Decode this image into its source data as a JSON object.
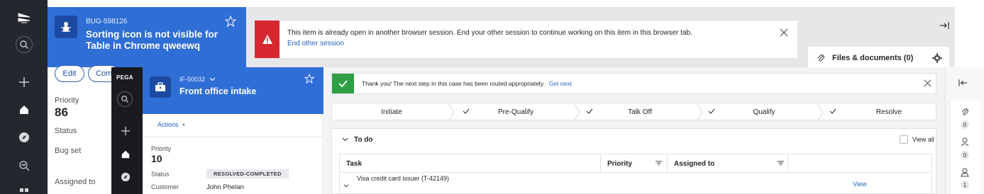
{
  "back_window": {
    "case_id": "BUG-598126",
    "case_title": "Sorting icon is not visible for Table in Chrome qweewq",
    "alert": {
      "message": "This item is already open in another browser session. End your other session to continue working on this item in this browser tab.",
      "link": "End other session"
    },
    "actions": {
      "edit": "Edit",
      "comment": "Com"
    },
    "fields": {
      "priority_label": "Priority",
      "priority_value": "86",
      "status_label": "Status",
      "bug_set_label": "Bug set",
      "assigned_label": "Assigned to"
    },
    "files_title": "Files & documents (0)"
  },
  "front_window": {
    "brand": "PEGA",
    "case_id": "IF-50032",
    "case_title": "Front office intake",
    "actions_label": "Actions",
    "fields": {
      "priority_label": "Priority",
      "priority_value": "10",
      "status_label": "Status",
      "status_value": "RESOLVED-COMPLETED",
      "customer_label": "Customer",
      "customer_value": "John Phelan"
    },
    "success": {
      "message": "Thank you! The next step in this case has been routed appropriately.",
      "link": "Get next"
    },
    "stages": [
      "Initiate",
      "Pre-Qualify",
      "Talk Off",
      "Qualify",
      "Resolve"
    ],
    "todo": {
      "title": "To do",
      "view_all": "View all",
      "columns": [
        "Task",
        "Priority",
        "Assigned to"
      ],
      "rows": [
        {
          "task": "Visa credit card issuer (T-42149)",
          "action": "View"
        }
      ]
    },
    "utility_counts": [
      "0",
      "0",
      "1"
    ]
  },
  "colors": {
    "header_blue": "#2f6ed5",
    "rail_dark": "#24272e",
    "alert_red": "#d7282f",
    "success_green": "#2f9e44",
    "link_blue": "#1f5fbf"
  }
}
